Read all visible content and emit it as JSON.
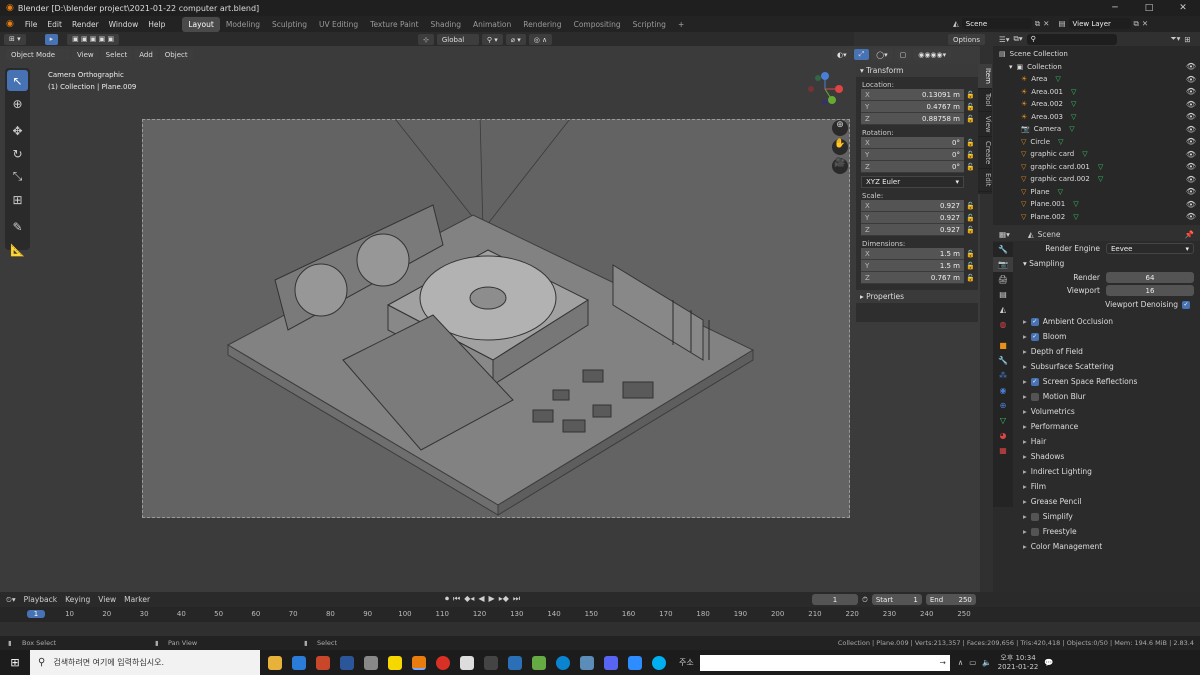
{
  "window": {
    "title": "Blender [D:\\blender project\\2021-01-22 computer art.blend]"
  },
  "menu": {
    "items": [
      "File",
      "Edit",
      "Render",
      "Window",
      "Help"
    ]
  },
  "workspaces": [
    "Layout",
    "Modeling",
    "Sculpting",
    "UV Editing",
    "Texture Paint",
    "Shading",
    "Animation",
    "Rendering",
    "Compositing",
    "Scripting"
  ],
  "scene": {
    "name": "Scene",
    "view_layer": "View Layer"
  },
  "viewport": {
    "transform_orientation": "Global",
    "mode": "Object Mode",
    "header_menus": [
      "View",
      "Select",
      "Add",
      "Object"
    ],
    "options": "Options",
    "camera_label": "Camera Orthographic",
    "collection_label": "(1) Collection | Plane.009"
  },
  "npanel": {
    "header": "Transform",
    "location_label": "Location:",
    "location": [
      {
        "axis": "X",
        "value": "0.13091 m"
      },
      {
        "axis": "Y",
        "value": "0.4767 m"
      },
      {
        "axis": "Z",
        "value": "0.88758 m"
      }
    ],
    "rotation_label": "Rotation:",
    "rotation": [
      {
        "axis": "X",
        "value": "0°"
      },
      {
        "axis": "Y",
        "value": "0°"
      },
      {
        "axis": "Z",
        "value": "0°"
      }
    ],
    "rotation_mode": "XYZ Euler",
    "scale_label": "Scale:",
    "scale": [
      {
        "axis": "X",
        "value": "0.927"
      },
      {
        "axis": "Y",
        "value": "0.927"
      },
      {
        "axis": "Z",
        "value": "0.927"
      }
    ],
    "dimensions_label": "Dimensions:",
    "dimensions": [
      {
        "axis": "X",
        "value": "1.5 m"
      },
      {
        "axis": "Y",
        "value": "1.5 m"
      },
      {
        "axis": "Z",
        "value": "0.767 m"
      }
    ],
    "properties": "Properties",
    "tabs": [
      "Item",
      "Tool",
      "View",
      "Create",
      "Edit"
    ]
  },
  "outliner": {
    "root": "Scene Collection",
    "collection": "Collection",
    "items": [
      {
        "name": "Area",
        "icon": "light-icon"
      },
      {
        "name": "Area.001",
        "icon": "light-icon"
      },
      {
        "name": "Area.002",
        "icon": "light-icon"
      },
      {
        "name": "Area.003",
        "icon": "light-icon"
      },
      {
        "name": "Camera",
        "icon": "camera-icon"
      },
      {
        "name": "Circle",
        "icon": "mesh-icon"
      },
      {
        "name": "graphic card",
        "icon": "mesh-icon"
      },
      {
        "name": "graphic card.001",
        "icon": "mesh-icon"
      },
      {
        "name": "graphic card.002",
        "icon": "mesh-icon"
      },
      {
        "name": "Plane",
        "icon": "mesh-icon"
      },
      {
        "name": "Plane.001",
        "icon": "mesh-icon"
      },
      {
        "name": "Plane.002",
        "icon": "mesh-icon"
      }
    ]
  },
  "properties": {
    "scene": "Scene",
    "render_engine_label": "Render Engine",
    "render_engine": "Eevee",
    "sampling": "Sampling",
    "render_label": "Render",
    "render_value": "64",
    "viewport_label": "Viewport",
    "viewport_value": "16",
    "viewport_denoising": "Viewport Denoising",
    "sections": [
      {
        "label": "Ambient Occlusion",
        "check": true
      },
      {
        "label": "Bloom",
        "check": true
      },
      {
        "label": "Depth of Field",
        "check": null
      },
      {
        "label": "Subsurface Scattering",
        "check": null
      },
      {
        "label": "Screen Space Reflections",
        "check": true
      },
      {
        "label": "Motion Blur",
        "check": false
      },
      {
        "label": "Volumetrics",
        "check": null
      },
      {
        "label": "Performance",
        "check": null
      },
      {
        "label": "Hair",
        "check": null
      },
      {
        "label": "Shadows",
        "check": null
      },
      {
        "label": "Indirect Lighting",
        "check": null
      },
      {
        "label": "Film",
        "check": null
      },
      {
        "label": "Grease Pencil",
        "check": null
      },
      {
        "label": "Simplify",
        "check": false
      },
      {
        "label": "Freestyle",
        "check": false
      },
      {
        "label": "Color Management",
        "check": null
      }
    ]
  },
  "timeline": {
    "menus": [
      "Playback",
      "Keying",
      "View",
      "Marker"
    ],
    "current_frame": "1",
    "start_label": "Start",
    "start": "1",
    "end_label": "End",
    "end": "250",
    "ticks": [
      "1",
      "10",
      "20",
      "30",
      "40",
      "50",
      "60",
      "70",
      "80",
      "90",
      "100",
      "110",
      "120",
      "130",
      "140",
      "150",
      "160",
      "170",
      "180",
      "190",
      "200",
      "210",
      "220",
      "230",
      "240",
      "250"
    ]
  },
  "status": {
    "box_select": "Box Select",
    "pan_view": "Pan View",
    "select": "Select",
    "info": "Collection | Plane.009 | Verts:213,357 | Faces:209,656 | Tris:420,418 | Objects:0/50 | Mem: 194.6 MiB | 2.83.4"
  },
  "taskbar": {
    "search_placeholder": "검색하려면 여기에 입력하십시오.",
    "address_label": "주소",
    "time": "오후 10:34",
    "date": "2021-01-22"
  }
}
